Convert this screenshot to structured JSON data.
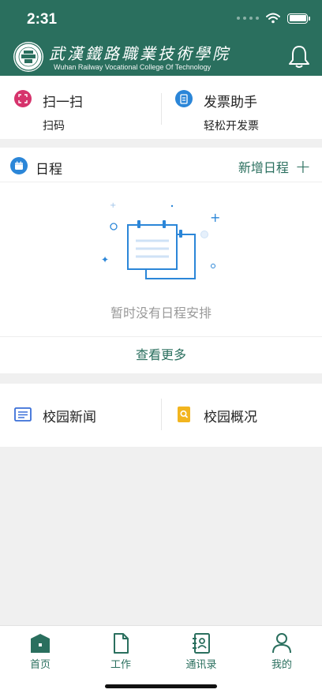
{
  "status_bar": {
    "time": "2:31",
    "signal_icon": "signal-dots-icon",
    "wifi_icon": "wifi-icon",
    "battery_icon": "battery-icon"
  },
  "header": {
    "college_name_cn": "武漢鐵路職業技術學院",
    "college_name_en": "Wuhan Railway Vocational College Of Technology",
    "logo_icon": "college-seal-logo",
    "notification_icon": "bell-icon",
    "brand_color": "#2a6f5e"
  },
  "quick_actions": [
    {
      "title": "扫一扫",
      "subtitle": "扫码",
      "icon": "scan-icon",
      "color": "#d6336c"
    },
    {
      "title": "发票助手",
      "subtitle": "轻松开发票",
      "icon": "invoice-icon",
      "color": "#2b86d8"
    }
  ],
  "schedule": {
    "title": "日程",
    "icon": "calendar-icon",
    "add_label": "新增日程",
    "empty_text": "暂时没有日程安排",
    "view_more": "查看更多"
  },
  "info_links": [
    {
      "title": "校园新闻",
      "icon": "news-icon",
      "color": "#3a6fd8"
    },
    {
      "title": "校园概况",
      "icon": "campus-overview-icon",
      "color": "#f2b51f"
    }
  ],
  "tabbar": {
    "items": [
      {
        "label": "首页",
        "icon": "home-icon",
        "active": true
      },
      {
        "label": "工作",
        "icon": "document-icon",
        "active": false
      },
      {
        "label": "通讯录",
        "icon": "contacts-icon",
        "active": false
      },
      {
        "label": "我的",
        "icon": "user-icon",
        "active": false
      }
    ]
  }
}
